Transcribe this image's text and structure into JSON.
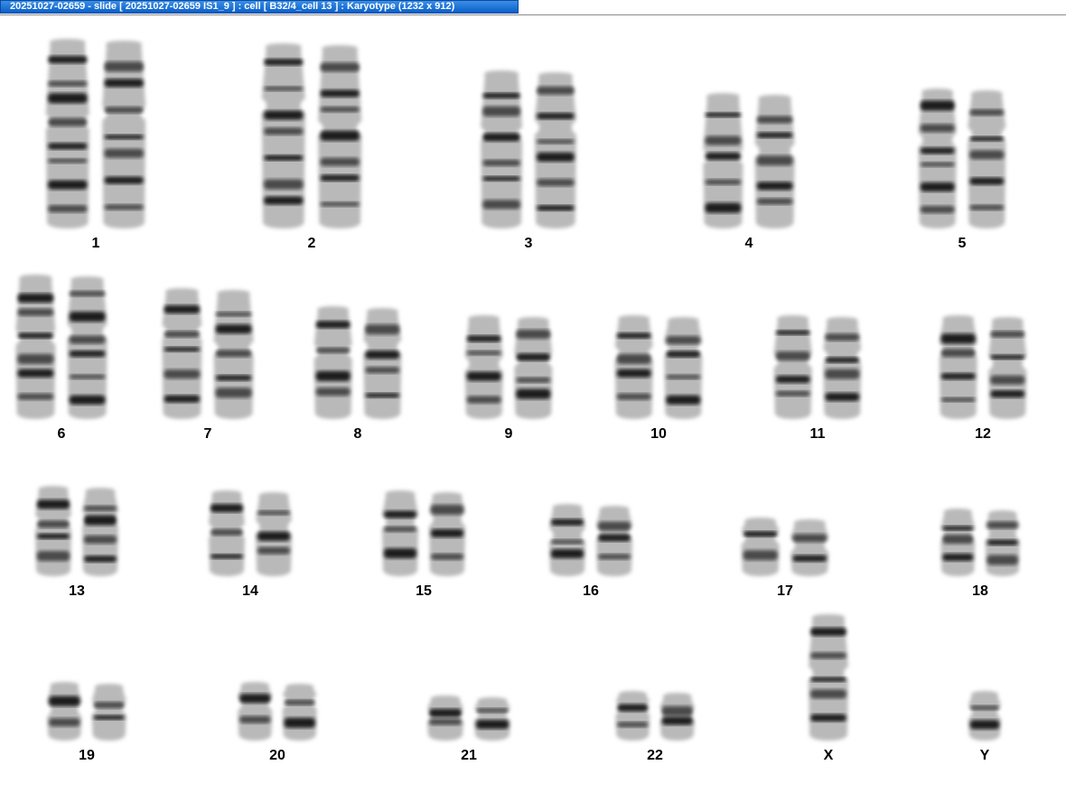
{
  "window": {
    "title": "20251027-02659 - slide [ 20251027-02659 IS1_9 ] : cell [ B32/4_cell 13 ] : Karyotype  (1232 x 912)"
  },
  "chromosomes": [
    {
      "label": "1"
    },
    {
      "label": "2"
    },
    {
      "label": "3"
    },
    {
      "label": "4"
    },
    {
      "label": "5"
    },
    {
      "label": "6"
    },
    {
      "label": "7"
    },
    {
      "label": "8"
    },
    {
      "label": "9"
    },
    {
      "label": "10"
    },
    {
      "label": "11"
    },
    {
      "label": "12"
    },
    {
      "label": "13"
    },
    {
      "label": "14"
    },
    {
      "label": "15"
    },
    {
      "label": "16"
    },
    {
      "label": "17"
    },
    {
      "label": "18"
    },
    {
      "label": "19"
    },
    {
      "label": "20"
    },
    {
      "label": "21"
    },
    {
      "label": "22"
    },
    {
      "label": "X"
    },
    {
      "label": "Y"
    }
  ]
}
